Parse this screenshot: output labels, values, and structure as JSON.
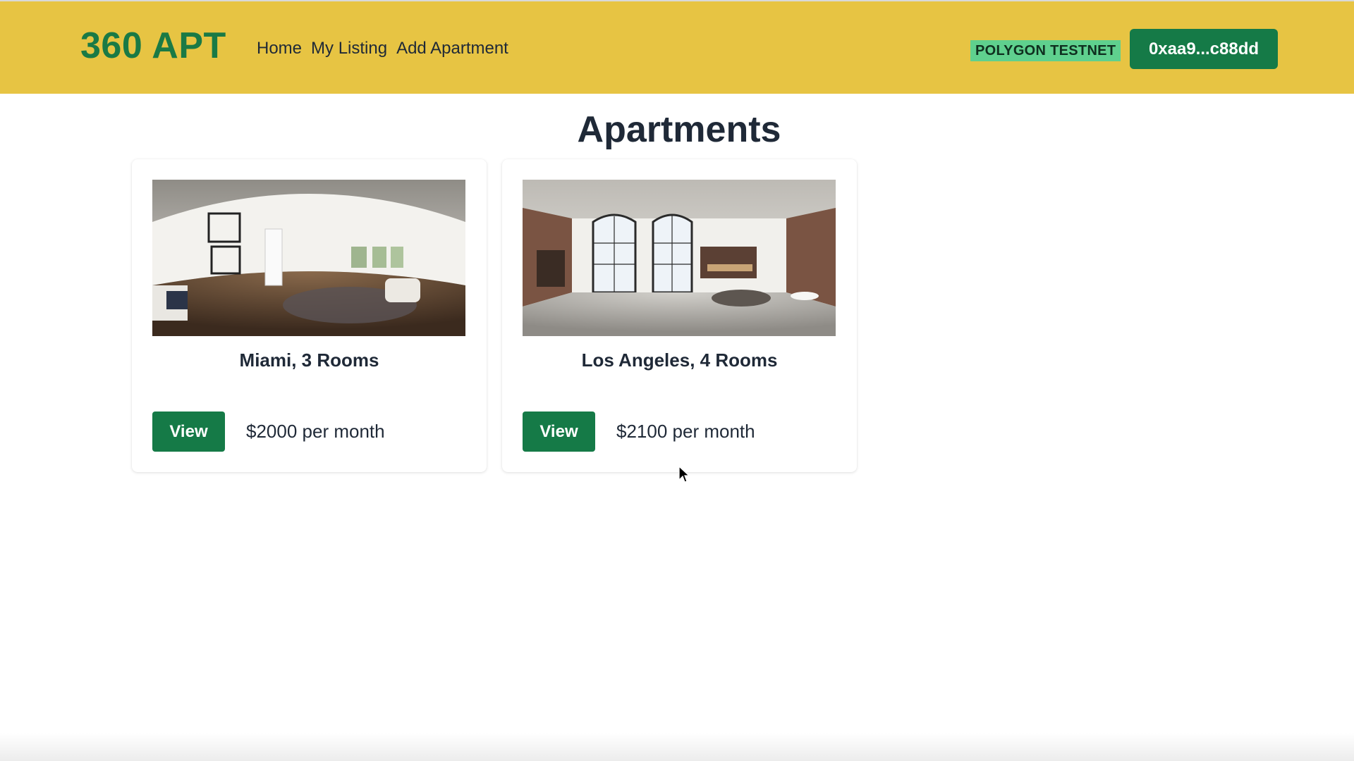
{
  "header": {
    "brand": "360 APT",
    "nav": [
      {
        "label": "Home"
      },
      {
        "label": "My Listing"
      },
      {
        "label": "Add Apartment"
      }
    ],
    "network_badge": "POLYGON TESTNET",
    "wallet_address": "0xaa9...c88dd"
  },
  "main": {
    "title": "Apartments",
    "listings": [
      {
        "title": "Miami, 3 Rooms",
        "view_label": "View",
        "price": "$2000 per month",
        "image": "panorama-living-room"
      },
      {
        "title": "Los Angeles, 4 Rooms",
        "view_label": "View",
        "price": "$2100 per month",
        "image": "panorama-loft"
      }
    ]
  },
  "colors": {
    "header_bg": "#e7c443",
    "brand_green": "#1a7a45",
    "button_green": "#157a47",
    "badge_bg": "#5fd08e"
  }
}
